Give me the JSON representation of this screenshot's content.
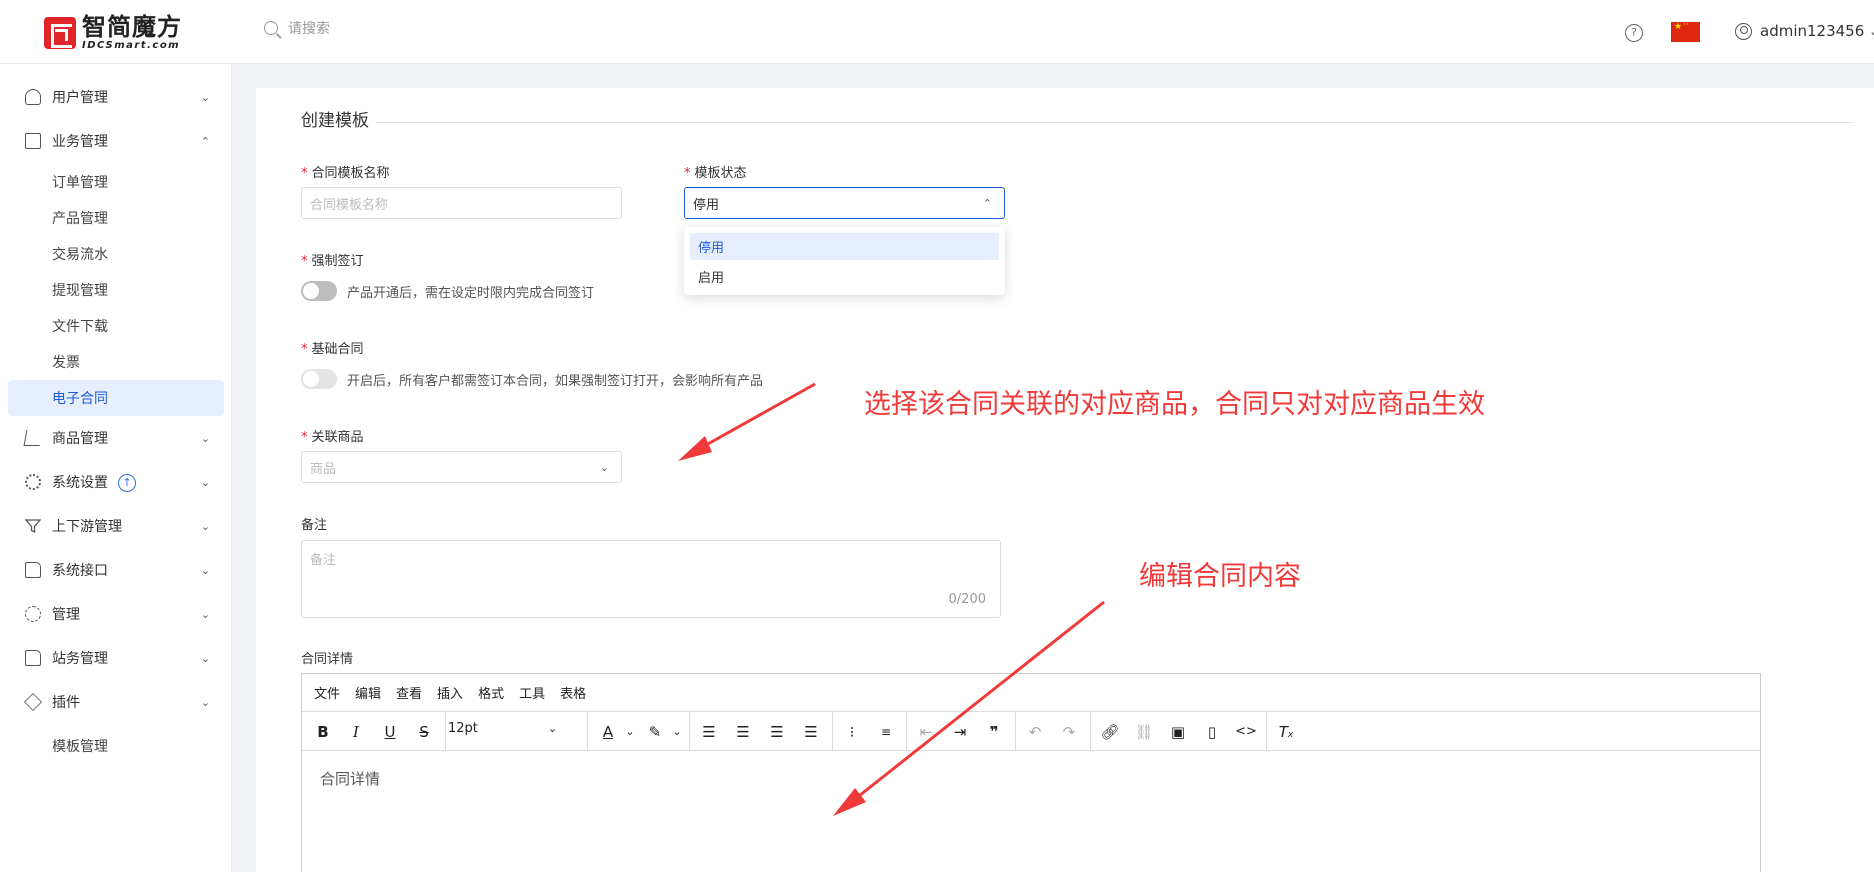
{
  "brand": {
    "name_cn": "智简魔方",
    "name_en": "IDCSmart.com"
  },
  "header": {
    "search_placeholder": "请搜索",
    "username": "admin123456"
  },
  "sidebar": {
    "items": [
      {
        "label": "用户管理",
        "icon": "user-icon"
      },
      {
        "label": "业务管理",
        "icon": "document-icon",
        "expanded": true
      },
      {
        "label": "商品管理",
        "icon": "cart-icon"
      },
      {
        "label": "系统设置",
        "icon": "gear-icon"
      },
      {
        "label": "上下游管理",
        "icon": "filter-icon"
      },
      {
        "label": "系统接口",
        "icon": "folder-icon"
      },
      {
        "label": "管理",
        "icon": "spark-icon"
      },
      {
        "label": "站务管理",
        "icon": "folder-plus-icon"
      },
      {
        "label": "插件",
        "icon": "box-icon"
      }
    ],
    "sub_items": [
      "订单管理",
      "产品管理",
      "交易流水",
      "提现管理",
      "文件下载",
      "发票",
      "电子合同"
    ],
    "plugin_sub": "模板管理",
    "active": "电子合同"
  },
  "form": {
    "section_title": "创建模板",
    "name_label": "合同模板名称",
    "name_placeholder": "合同模板名称",
    "status_label": "模板状态",
    "status_value": "停用",
    "status_options": [
      "停用",
      "启用"
    ],
    "force_sign_label": "强制签订",
    "force_sign_hint": "产品开通后，需在设定时限内完成合同签订",
    "base_contract_label": "基础合同",
    "base_contract_hint": "开启后，所有客户都需签订本合同，如果强制签订打开，会影响所有产品",
    "product_label": "关联商品",
    "product_placeholder": "商品",
    "note_label": "备注",
    "note_placeholder": "备注",
    "note_counter": "0/200",
    "detail_label": "合同详情",
    "detail_placeholder": "合同详情"
  },
  "editor": {
    "menus": [
      "文件",
      "编辑",
      "查看",
      "插入",
      "格式",
      "工具",
      "表格"
    ],
    "font_size": "12pt"
  },
  "annotations": {
    "product_note": "选择该合同关联的对应商品，合同只对对应商品生效",
    "editor_note": "编辑合同内容",
    "color": "#f03a3a"
  }
}
